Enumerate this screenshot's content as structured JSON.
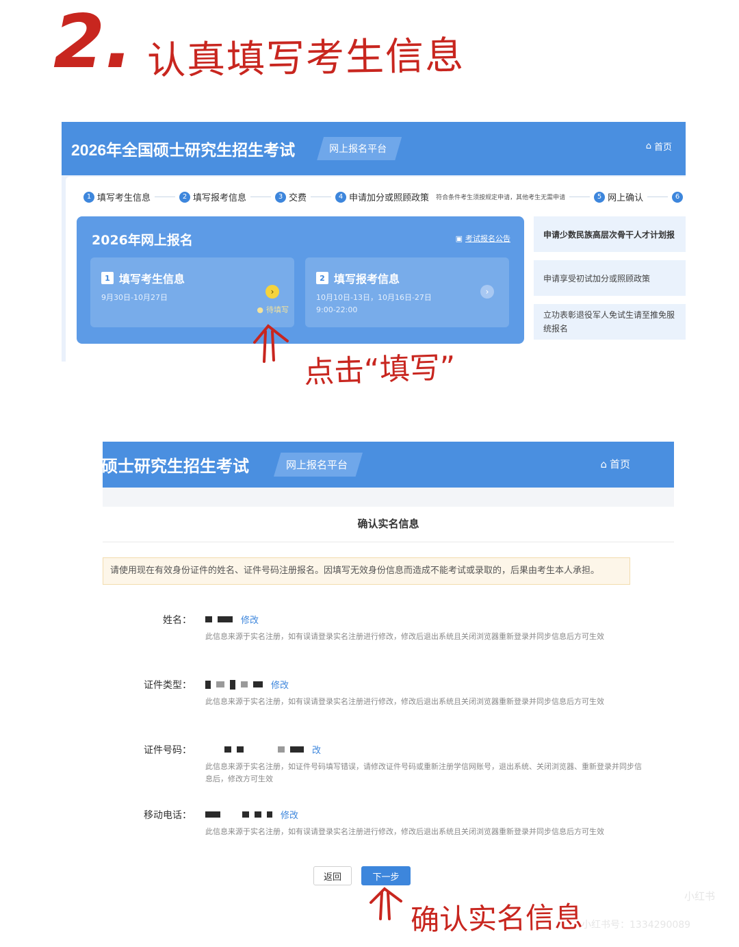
{
  "annotation": {
    "step_number": "2.",
    "step_title": "认真填写考生信息",
    "click_note": "点击“填写”",
    "confirm_note": "确认实名信息"
  },
  "screen1": {
    "title": "2026年全国硕士研究生招生考试",
    "platform_tag": "网上报名平台",
    "home": "首页",
    "steps": [
      {
        "num": "1",
        "label": "填写考生信息"
      },
      {
        "num": "2",
        "label": "填写报考信息"
      },
      {
        "num": "3",
        "label": "交费"
      },
      {
        "num": "4",
        "label": "申请加分或照顾政策",
        "note": "符合条件考生须按规定申请，其他考生无需申请"
      },
      {
        "num": "5",
        "label": "网上确认"
      },
      {
        "num": "6",
        "label": ""
      }
    ],
    "card_title": "2026年网上报名",
    "notice_link": "考试报名公告",
    "card1": {
      "num": "1",
      "title": "填写考生信息",
      "date": "9月30日-10月27日",
      "status": "待填写"
    },
    "card2": {
      "num": "2",
      "title": "填写报考信息",
      "date_line1": "10月10日-13日，10月16日-27日",
      "date_line2": "9:00-22:00"
    },
    "side_items": [
      "申请少数民族高层次骨干人才计划报",
      "申请享受初试加分或照顾政策",
      "立功表彰退役军人免试生请至推免服",
      "统报名"
    ]
  },
  "screen2": {
    "title": "硕士研究生招生考试",
    "platform_tag": "网上报名平台",
    "home": "首页",
    "page_title": "确认实名信息",
    "warning": "请使用现在有效身份证件的姓名、证件号码注册报名。因填写无效身份信息而造成不能考试或录取的，后果由考生本人承担。",
    "fields": [
      {
        "label": "姓名：",
        "edit": "修改",
        "hint": "此信息来源于实名注册，如有误请登录实名注册进行修改，修改后退出系统且关闭浏览器重新登录并同步信息后方可生效"
      },
      {
        "label": "证件类型：",
        "edit": "修改",
        "hint": "此信息来源于实名注册，如有误请登录实名注册进行修改，修改后退出系统且关闭浏览器重新登录并同步信息后方可生效"
      },
      {
        "label": "证件号码：",
        "edit": "改",
        "hint": "此信息来源于实名注册，如证件号码填写错误，请修改证件号码或重新注册学信网账号，退出系统、关闭浏览器、重新登录并同步信息后，修改方可生效"
      },
      {
        "label": "移动电话：",
        "edit": "修改",
        "hint": "此信息来源于实名注册，如有误请登录实名注册进行修改，修改后退出系统且关闭浏览器重新登录并同步信息后方可生效"
      }
    ],
    "back_button": "返回",
    "next_button": "下一步"
  },
  "watermark": {
    "logo": "小红书",
    "id": "小红书号：1334290089"
  },
  "colors": {
    "annotation_red": "#c8261f",
    "header_blue": "#4a8fe0",
    "accent_blue": "#3d86dc"
  }
}
